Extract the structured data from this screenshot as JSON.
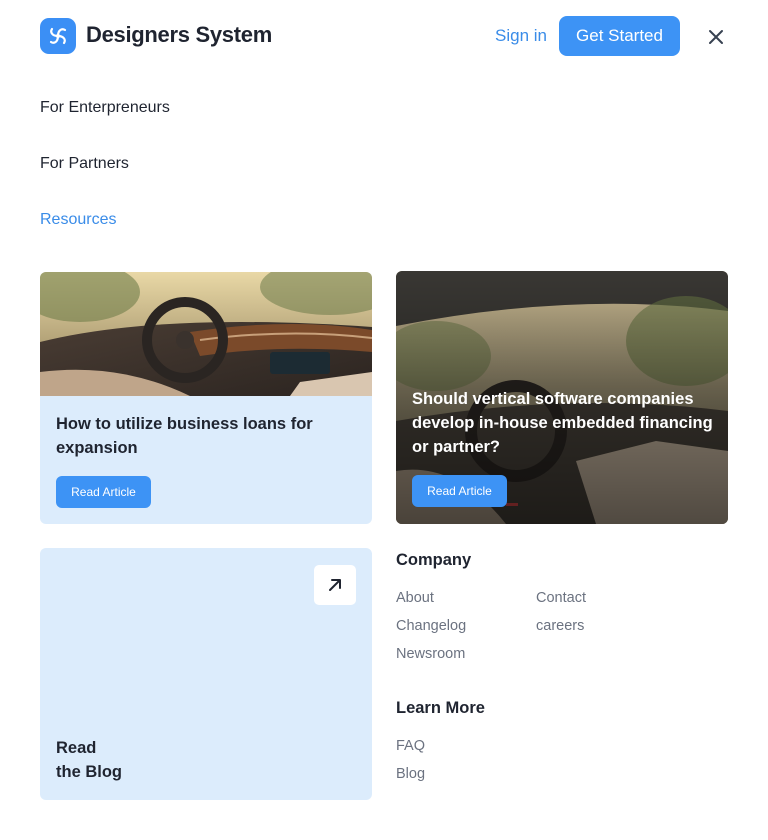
{
  "header": {
    "brand": "Designers System",
    "sign_in": "Sign in",
    "get_started": "Get Started",
    "accent": "#3d93f5"
  },
  "nav": {
    "items": [
      {
        "label": "For Enterpreneurs"
      },
      {
        "label": "For Partners"
      },
      {
        "label": "Resources"
      }
    ]
  },
  "resources": {
    "articles": [
      {
        "title_lines": [
          "How to utilize business loans for",
          "expansion"
        ],
        "button": "Read Article"
      },
      {
        "title_lines": [
          "Should vertical software companies",
          "develop in-house embedded financing",
          "or partner?"
        ],
        "button": "Read Article"
      }
    ],
    "blog": {
      "lines": [
        "Read",
        "the Blog"
      ],
      "icon": "arrow-up-right-icon"
    }
  },
  "company": {
    "title": "Company",
    "links": [
      "About",
      "Changelog",
      "Newsroom",
      "Contact",
      "careers"
    ]
  },
  "learn_more": {
    "title": "Learn More",
    "links": [
      "FAQ",
      "Blog"
    ]
  }
}
